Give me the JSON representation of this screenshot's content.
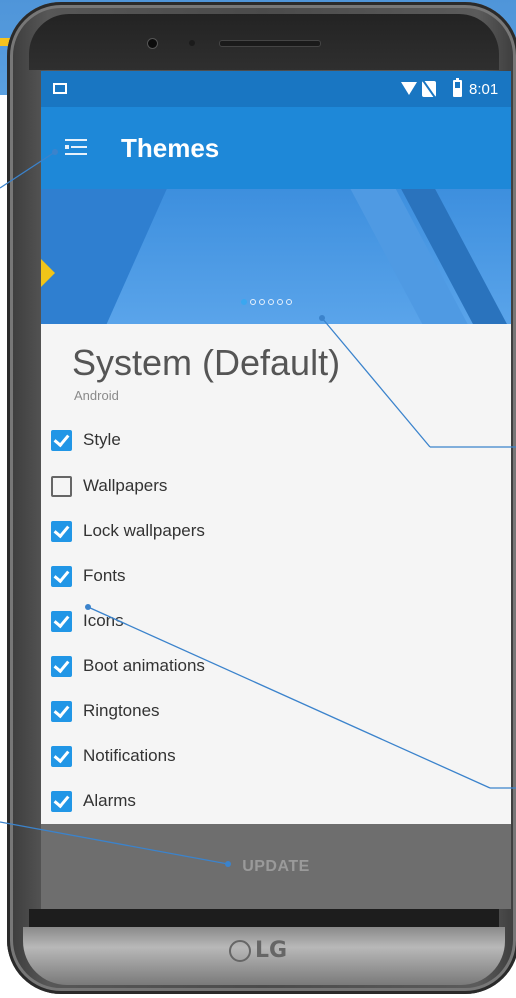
{
  "status_bar": {
    "time": "8:01"
  },
  "app_bar": {
    "title": "Themes"
  },
  "banner": {
    "page_count": 6,
    "active_page": 1
  },
  "theme": {
    "name": "System (Default)",
    "package": "Android"
  },
  "options": [
    {
      "label": "Style",
      "checked": true
    },
    {
      "label": "Wallpapers",
      "checked": false
    },
    {
      "label": "Lock wallpapers",
      "checked": true
    },
    {
      "label": "Fonts",
      "checked": true
    },
    {
      "label": "Icons",
      "checked": true
    },
    {
      "label": "Boot animations",
      "checked": true
    },
    {
      "label": "Ringtones",
      "checked": true
    },
    {
      "label": "Notifications",
      "checked": true
    },
    {
      "label": "Alarms",
      "checked": true
    }
  ],
  "action": {
    "update_label": "UPDATE"
  },
  "device": {
    "brand": "LG"
  },
  "colors": {
    "accent": "#2196e6",
    "app_bar": "#1e88d8",
    "status_bar": "#1976c2",
    "update_bar": "#6e6e6e"
  }
}
